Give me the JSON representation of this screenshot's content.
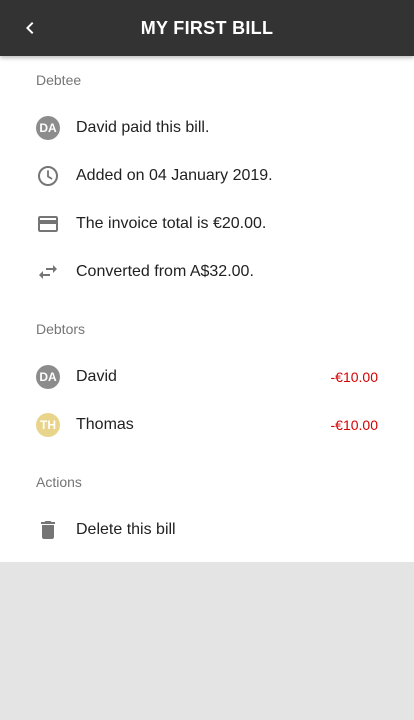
{
  "app_bar": {
    "title": "MY FIRST BILL",
    "back_icon": "chevron-left-icon"
  },
  "debtee": {
    "header": "Debtee",
    "payer": {
      "initials": "DA",
      "avatar_color": "#8c8c8c",
      "text": "David paid this bill."
    },
    "added": {
      "icon": "clock-icon",
      "text": "Added on 04 January 2019."
    },
    "total": {
      "icon": "credit-card-icon",
      "text": "The invoice total is €20.00."
    },
    "converted": {
      "icon": "swap-icon",
      "text": "Converted from A$32.00."
    }
  },
  "debtors": {
    "header": "Debtors",
    "items": [
      {
        "initials": "DA",
        "avatar_color": "#8c8c8c",
        "name": "David",
        "amount": "-€10.00"
      },
      {
        "initials": "TH",
        "avatar_color": "#e8d48a",
        "name": "Thomas",
        "amount": "-€10.00"
      }
    ]
  },
  "actions": {
    "header": "Actions",
    "delete": {
      "icon": "trash-icon",
      "label": "Delete this bill"
    }
  },
  "colors": {
    "app_bar": "#333333",
    "negative_amount": "#d50000",
    "background": "#e4e4e4"
  }
}
